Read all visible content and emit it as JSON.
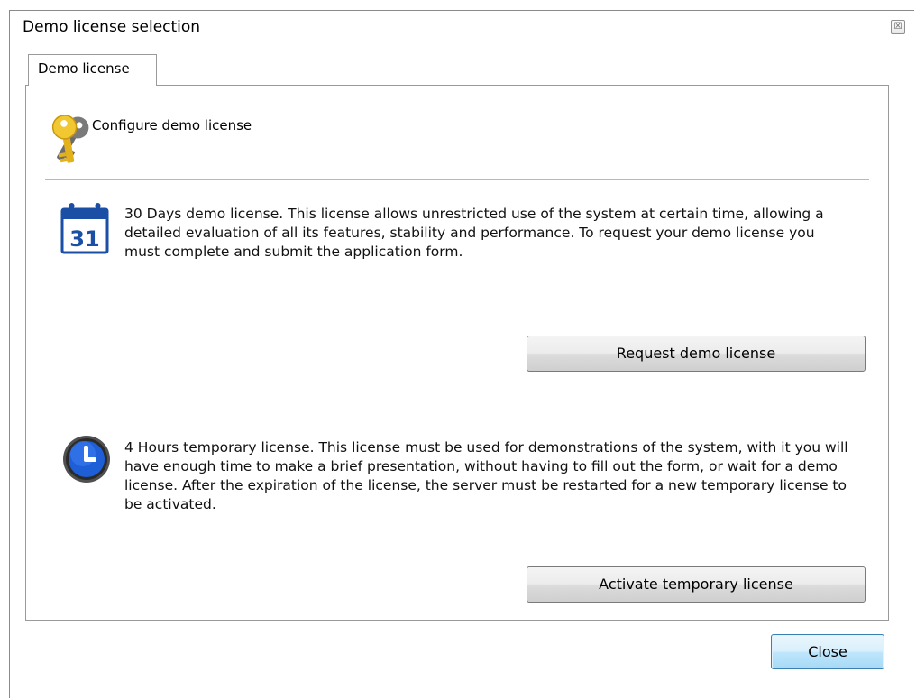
{
  "window": {
    "title": "Demo license selection",
    "close_glyph": "☒"
  },
  "tabs": [
    {
      "label": "Demo license",
      "active": true
    }
  ],
  "header": {
    "icon": "key-icon",
    "label": "Configure demo license"
  },
  "options": [
    {
      "icon": "calendar-icon",
      "calendar_day": "31",
      "description": "30 Days demo license. This license allows unrestricted use of the system at certain time, allowing a detailed evaluation of all its features, stability and performance. To request your demo license you must complete and submit the application form.",
      "button_label": "Request demo license"
    },
    {
      "icon": "clock-icon",
      "description": "4 Hours temporary license. This license must be used for demonstrations of the system, with it you will have enough time to make a brief presentation, without having to fill out the form, or wait for a demo license. After the expiration of the license, the server must be restarted for a new temporary license to be activated.",
      "button_label": "Activate temporary license"
    }
  ],
  "footer": {
    "close_label": "Close"
  },
  "colors": {
    "accent_blue": "#1a56b8",
    "key_gold": "#e8b820",
    "default_button_border": "#3c7fb1"
  }
}
